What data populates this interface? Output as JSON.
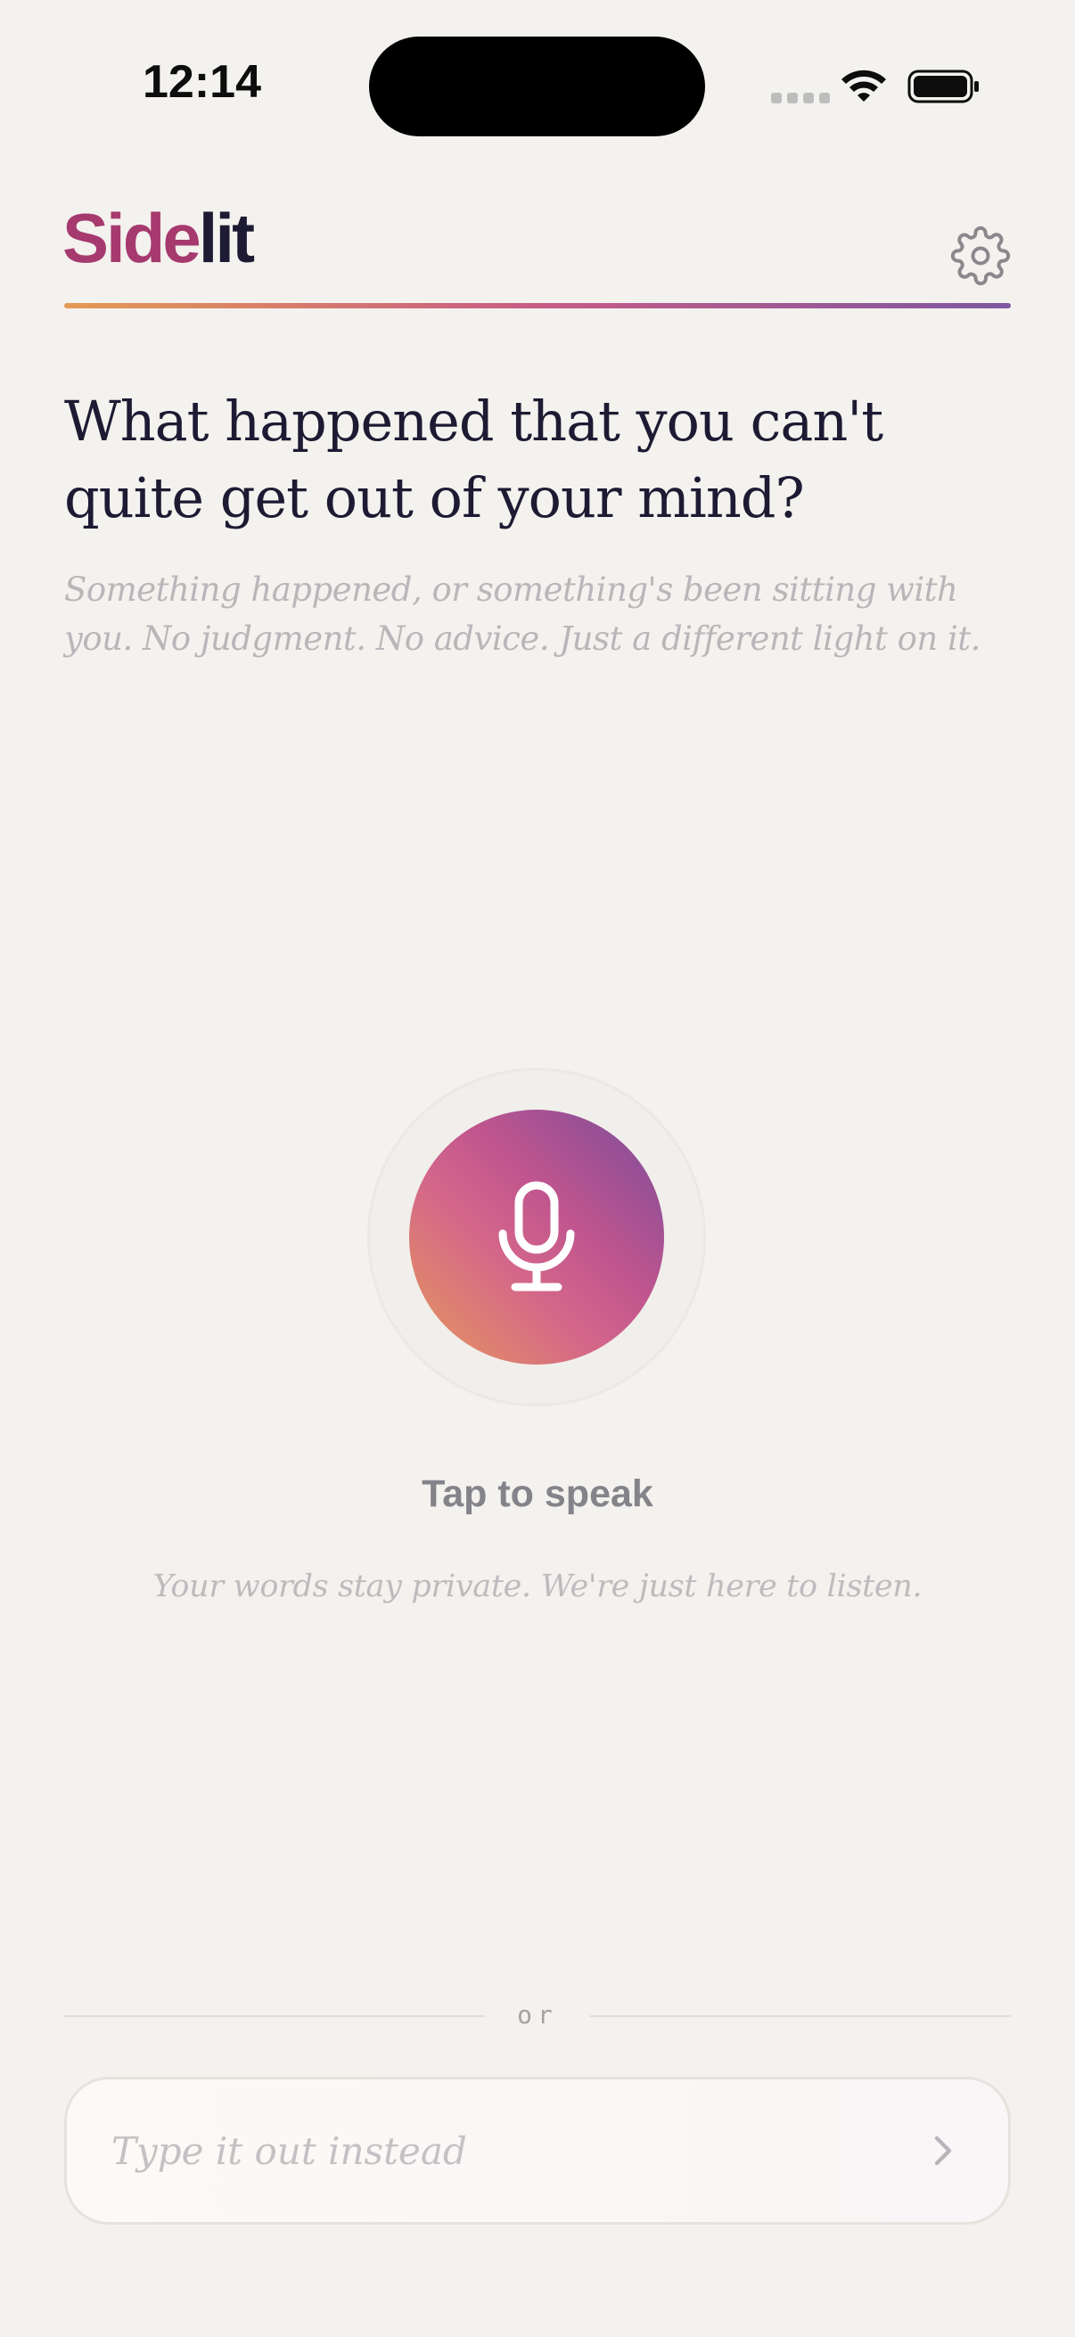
{
  "status_bar": {
    "time": "12:14"
  },
  "header": {
    "brand_part1": "Side",
    "brand_part2": "lit",
    "settings_icon": "gear-icon"
  },
  "prompt": {
    "heading": "What happened that you can't quite get out of your mind?",
    "subtext": "Something happened, or something's been sitting with you. No judgment. No advice. Just a different light on it."
  },
  "voice": {
    "icon": "microphone-icon",
    "label": "Tap to speak",
    "privacy_note": "Your words stay private. We're just here to listen."
  },
  "divider": {
    "text": "or"
  },
  "text_entry": {
    "placeholder": "Type it out instead",
    "value": "",
    "submit_icon": "chevron-right-icon"
  },
  "colors": {
    "background": "#f4f2ee",
    "brand_magenta": "#a63a6f",
    "brand_navy": "#1d1b33",
    "gradient_orange": "#e7985a",
    "gradient_pink": "#c85b86",
    "gradient_purple": "#7a4c9b"
  }
}
